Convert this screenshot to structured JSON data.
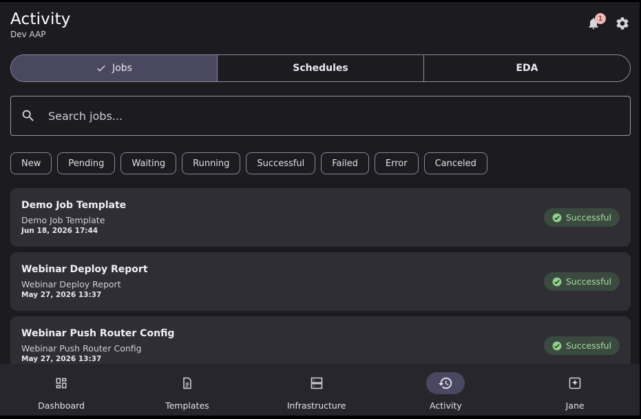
{
  "header": {
    "title": "Activity",
    "subtitle": "Dev AAP",
    "notification_count": "1"
  },
  "tabs": [
    {
      "label": "Jobs",
      "selected": true
    },
    {
      "label": "Schedules",
      "selected": false
    },
    {
      "label": "EDA",
      "selected": false
    }
  ],
  "search": {
    "placeholder": "Search jobs..."
  },
  "filters": [
    "New",
    "Pending",
    "Waiting",
    "Running",
    "Successful",
    "Failed",
    "Error",
    "Canceled"
  ],
  "jobs": [
    {
      "title": "Demo Job Template",
      "subtitle": "Demo Job Template",
      "date": "Jun 18, 2026 17:44",
      "status": "Successful"
    },
    {
      "title": "Webinar Deploy Report",
      "subtitle": "Webinar Deploy Report",
      "date": "May 27, 2026 13:37",
      "status": "Successful"
    },
    {
      "title": "Webinar Push Router Config",
      "subtitle": "Webinar Push Router Config",
      "date": "May 27, 2026 13:37",
      "status": "Successful"
    }
  ],
  "nav": [
    {
      "label": "Dashboard",
      "icon": "dashboard-icon"
    },
    {
      "label": "Templates",
      "icon": "document-icon"
    },
    {
      "label": "Infrastructure",
      "icon": "server-icon"
    },
    {
      "label": "Activity",
      "icon": "history-icon",
      "active": true
    },
    {
      "label": "Jane",
      "icon": "account-box-icon"
    }
  ],
  "colors": {
    "background": "#1c1b20",
    "card": "#2f2e34",
    "active_tab": "#4a4760",
    "success_bg": "#3b4a3e",
    "success_fg": "#a9d8a6"
  }
}
